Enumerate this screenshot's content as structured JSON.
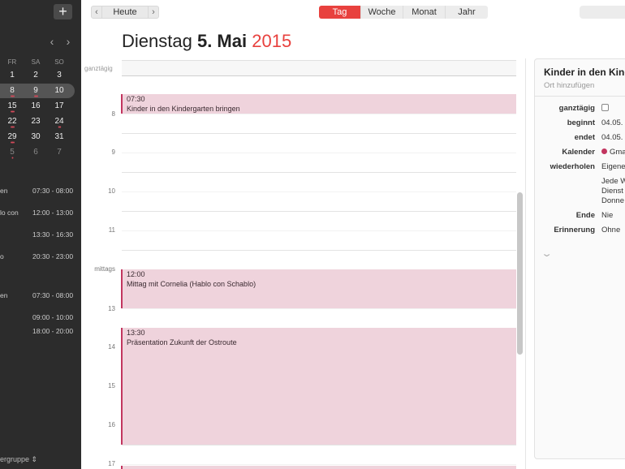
{
  "toolbar": {
    "add_label": "+",
    "prev_label": "‹",
    "today_label": "Heute",
    "next_label": "›",
    "views": [
      "Tag",
      "Woche",
      "Monat",
      "Jahr"
    ],
    "active_view": "Tag"
  },
  "sidebar": {
    "nav_prev": "‹",
    "nav_next": "›",
    "weekdays": [
      "FR",
      "SA",
      "SO"
    ],
    "weeks": [
      [
        "1",
        "2",
        "3"
      ],
      [
        "8",
        "9",
        "10"
      ],
      [
        "15",
        "16",
        "17"
      ],
      [
        "22",
        "23",
        "24"
      ],
      [
        "29",
        "30",
        "31"
      ],
      [
        "5",
        "6",
        "7"
      ]
    ],
    "events": [
      {
        "name": "en",
        "time": "07:30 - 08:00"
      },
      {
        "name": "lo con",
        "time": "12:00 - 13:00"
      },
      {
        "name": "",
        "time": "13:30 - 16:30"
      },
      {
        "name": "o",
        "time": "20:30 - 23:00"
      },
      {
        "name": "en",
        "time": "07:30 - 08:00"
      },
      {
        "name": "",
        "time": "09:00 - 10:00"
      },
      {
        "name": "",
        "time": "18:00 - 20:00"
      }
    ],
    "calendar_group": "ergruppe ⇕"
  },
  "header": {
    "weekday": "Dienstag",
    "day_month": "5. Mai",
    "year": "2015"
  },
  "day_view": {
    "allday_label": "ganztägig",
    "hours": [
      "8",
      "9",
      "10",
      "11",
      "mittags",
      "13",
      "14",
      "15",
      "16",
      "17"
    ],
    "events": [
      {
        "time": "07:30",
        "title": "Kinder in den Kindergarten bringen"
      },
      {
        "time": "12:00",
        "title": "Mittag mit Cornelia (Hablo con Schablo)"
      },
      {
        "time": "13:30",
        "title": "Präsentation Zukunft der Ostroute"
      }
    ]
  },
  "inspector": {
    "title": "Kinder in den Kind",
    "location_placeholder": "Ort hinzufügen",
    "allday_label": "ganztägig",
    "begins_label": "beginnt",
    "begins_value": "04.05.",
    "ends_label": "endet",
    "ends_value": "04.05.",
    "calendar_label": "Kalender",
    "calendar_value": "Gma",
    "repeat_label": "wiederholen",
    "repeat_value": "Eigene",
    "repeat_detail": [
      "Jede W",
      "Dienst",
      "Donne"
    ],
    "end_label": "Ende",
    "end_value": "Nie",
    "reminder_label": "Erinnerung",
    "reminder_value": "Ohne",
    "expand_icon": "chevron-down-icon"
  },
  "colors": {
    "accent": "#e8413e",
    "event_fill": "#efd3dc",
    "event_bar": "#c2355f",
    "sidebar_bg": "#2c2c2c"
  }
}
